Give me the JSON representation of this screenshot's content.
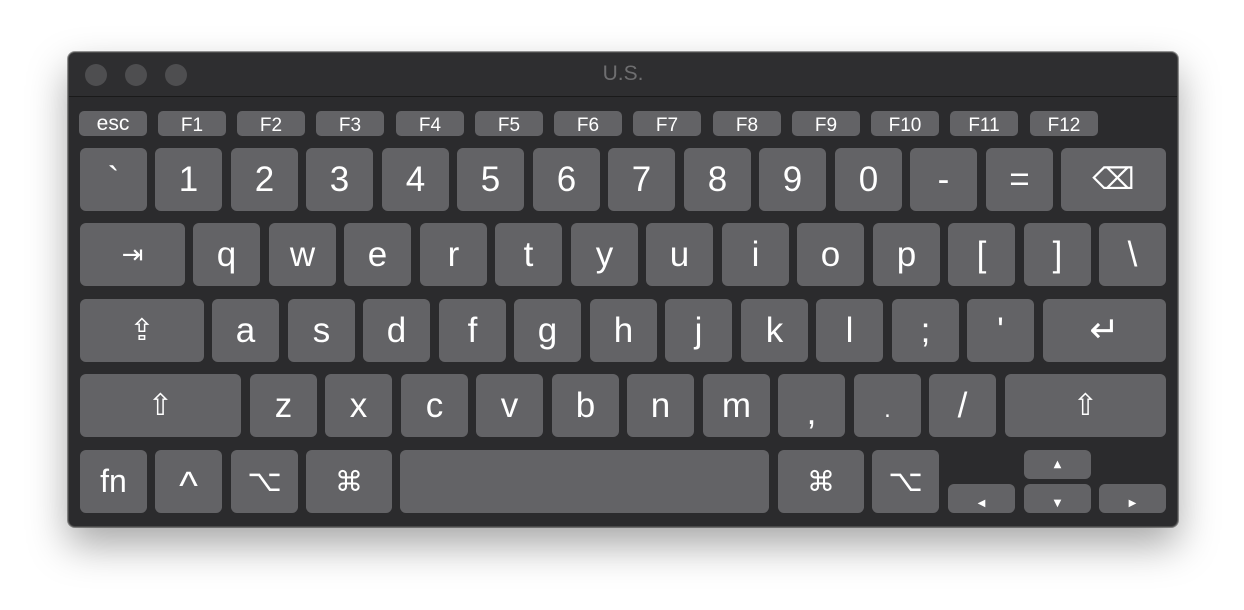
{
  "window": {
    "title": "U.S."
  },
  "rows": {
    "fn_row": [
      "esc",
      "F1",
      "F2",
      "F3",
      "F4",
      "F5",
      "F6",
      "F7",
      "F8",
      "F9",
      "F10",
      "F11",
      "F12"
    ],
    "number_row": [
      "`",
      "1",
      "2",
      "3",
      "4",
      "5",
      "6",
      "7",
      "8",
      "9",
      "0",
      "-",
      "="
    ],
    "top_row": [
      "q",
      "w",
      "e",
      "r",
      "t",
      "y",
      "u",
      "i",
      "o",
      "p",
      "[",
      "]",
      "\\"
    ],
    "home_row": [
      "a",
      "s",
      "d",
      "f",
      "g",
      "h",
      "j",
      "k",
      "l",
      ";",
      "'"
    ],
    "bottom_row": [
      "z",
      "x",
      "c",
      "v",
      "b",
      "n",
      "m",
      ",",
      ".",
      "/"
    ]
  },
  "mods": {
    "delete": "⌫",
    "tab": "⇥",
    "caps_lock": "⇪",
    "return": "↵",
    "shift": "⇧",
    "fn": "fn",
    "control": "^",
    "option": "⌥",
    "command": "⌘",
    "arrow_up": "▲",
    "arrow_down": "▼",
    "arrow_left": "◀",
    "arrow_right": "▶"
  }
}
